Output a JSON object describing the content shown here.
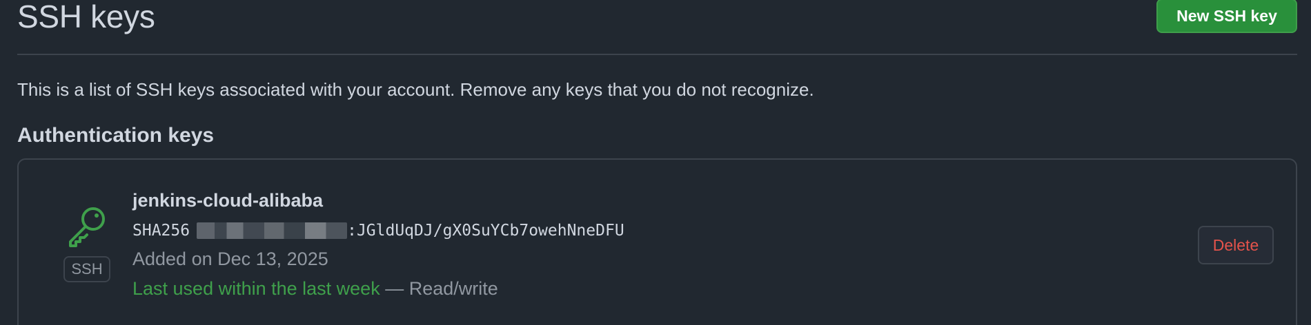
{
  "header": {
    "title": "SSH keys",
    "new_key_label": "New SSH key"
  },
  "intro": "This is a list of SSH keys associated with your account. Remove any keys that you do not recognize.",
  "section_title": "Authentication keys",
  "keys": [
    {
      "badge": "SSH",
      "title": "jenkins-cloud-alibaba",
      "fingerprint_prefix": "SHA256",
      "fingerprint_visible": ":JGldUqDJ/gX0SuYCb7owehNneDFU",
      "added_on": "Added on Dec 13, 2025",
      "last_used": "Last used within the last week",
      "access_separator": " — Read/write",
      "delete_label": "Delete",
      "icon": "key-icon"
    }
  ],
  "colors": {
    "background": "#212830",
    "primary_button": "#29903b",
    "danger_text": "#e5534b",
    "success_text": "#3fa04b",
    "muted_text": "#9198a1",
    "border": "#3d444d"
  }
}
